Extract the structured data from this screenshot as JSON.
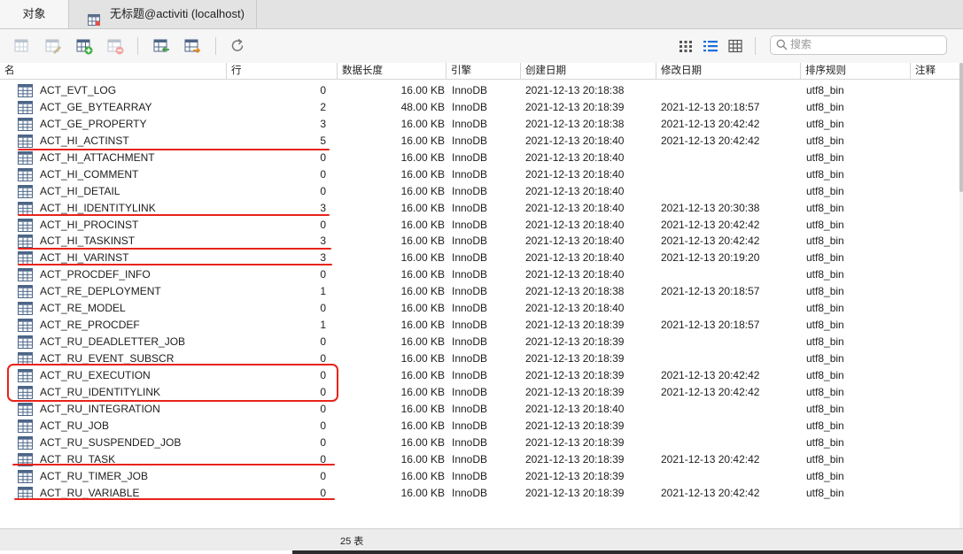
{
  "tabs": {
    "objects": "对象",
    "query": "无标题@activiti (localhost)"
  },
  "search": {
    "placeholder": "搜索"
  },
  "toolbar": {
    "icons": [
      "open-table-icon",
      "design-table-icon",
      "new-table-icon",
      "delete-table-icon",
      "import-icon",
      "export-icon",
      "refresh-icon",
      "view-icons-icon",
      "view-list-icon",
      "view-detail-icon"
    ]
  },
  "columns": {
    "name": "名",
    "rows": "行",
    "data_length": "数据长度",
    "engine": "引擎",
    "created": "创建日期",
    "modified": "修改日期",
    "collation": "排序规则",
    "comment": "注释"
  },
  "tables": [
    {
      "name": "ACT_EVT_LOG",
      "rows": "0",
      "len": "16.00 KB",
      "engine": "InnoDB",
      "created": "2021-12-13 20:18:38",
      "modified": "",
      "coll": "utf8_bin"
    },
    {
      "name": "ACT_GE_BYTEARRAY",
      "rows": "2",
      "len": "48.00 KB",
      "engine": "InnoDB",
      "created": "2021-12-13 20:18:39",
      "modified": "2021-12-13 20:18:57",
      "coll": "utf8_bin"
    },
    {
      "name": "ACT_GE_PROPERTY",
      "rows": "3",
      "len": "16.00 KB",
      "engine": "InnoDB",
      "created": "2021-12-13 20:18:38",
      "modified": "2021-12-13 20:42:42",
      "coll": "utf8_bin"
    },
    {
      "name": "ACT_HI_ACTINST",
      "rows": "5",
      "len": "16.00 KB",
      "engine": "InnoDB",
      "created": "2021-12-13 20:18:40",
      "modified": "2021-12-13 20:42:42",
      "coll": "utf8_bin"
    },
    {
      "name": "ACT_HI_ATTACHMENT",
      "rows": "0",
      "len": "16.00 KB",
      "engine": "InnoDB",
      "created": "2021-12-13 20:18:40",
      "modified": "",
      "coll": "utf8_bin"
    },
    {
      "name": "ACT_HI_COMMENT",
      "rows": "0",
      "len": "16.00 KB",
      "engine": "InnoDB",
      "created": "2021-12-13 20:18:40",
      "modified": "",
      "coll": "utf8_bin"
    },
    {
      "name": "ACT_HI_DETAIL",
      "rows": "0",
      "len": "16.00 KB",
      "engine": "InnoDB",
      "created": "2021-12-13 20:18:40",
      "modified": "",
      "coll": "utf8_bin"
    },
    {
      "name": "ACT_HI_IDENTITYLINK",
      "rows": "3",
      "len": "16.00 KB",
      "engine": "InnoDB",
      "created": "2021-12-13 20:18:40",
      "modified": "2021-12-13 20:30:38",
      "coll": "utf8_bin"
    },
    {
      "name": "ACT_HI_PROCINST",
      "rows": "0",
      "len": "16.00 KB",
      "engine": "InnoDB",
      "created": "2021-12-13 20:18:40",
      "modified": "2021-12-13 20:42:42",
      "coll": "utf8_bin"
    },
    {
      "name": "ACT_HI_TASKINST",
      "rows": "3",
      "len": "16.00 KB",
      "engine": "InnoDB",
      "created": "2021-12-13 20:18:40",
      "modified": "2021-12-13 20:42:42",
      "coll": "utf8_bin"
    },
    {
      "name": "ACT_HI_VARINST",
      "rows": "3",
      "len": "16.00 KB",
      "engine": "InnoDB",
      "created": "2021-12-13 20:18:40",
      "modified": "2021-12-13 20:19:20",
      "coll": "utf8_bin"
    },
    {
      "name": "ACT_PROCDEF_INFO",
      "rows": "0",
      "len": "16.00 KB",
      "engine": "InnoDB",
      "created": "2021-12-13 20:18:40",
      "modified": "",
      "coll": "utf8_bin"
    },
    {
      "name": "ACT_RE_DEPLOYMENT",
      "rows": "1",
      "len": "16.00 KB",
      "engine": "InnoDB",
      "created": "2021-12-13 20:18:38",
      "modified": "2021-12-13 20:18:57",
      "coll": "utf8_bin"
    },
    {
      "name": "ACT_RE_MODEL",
      "rows": "0",
      "len": "16.00 KB",
      "engine": "InnoDB",
      "created": "2021-12-13 20:18:40",
      "modified": "",
      "coll": "utf8_bin"
    },
    {
      "name": "ACT_RE_PROCDEF",
      "rows": "1",
      "len": "16.00 KB",
      "engine": "InnoDB",
      "created": "2021-12-13 20:18:39",
      "modified": "2021-12-13 20:18:57",
      "coll": "utf8_bin"
    },
    {
      "name": "ACT_RU_DEADLETTER_JOB",
      "rows": "0",
      "len": "16.00 KB",
      "engine": "InnoDB",
      "created": "2021-12-13 20:18:39",
      "modified": "",
      "coll": "utf8_bin"
    },
    {
      "name": "ACT_RU_EVENT_SUBSCR",
      "rows": "0",
      "len": "16.00 KB",
      "engine": "InnoDB",
      "created": "2021-12-13 20:18:39",
      "modified": "",
      "coll": "utf8_bin"
    },
    {
      "name": "ACT_RU_EXECUTION",
      "rows": "0",
      "len": "16.00 KB",
      "engine": "InnoDB",
      "created": "2021-12-13 20:18:39",
      "modified": "2021-12-13 20:42:42",
      "coll": "utf8_bin"
    },
    {
      "name": "ACT_RU_IDENTITYLINK",
      "rows": "0",
      "len": "16.00 KB",
      "engine": "InnoDB",
      "created": "2021-12-13 20:18:39",
      "modified": "2021-12-13 20:42:42",
      "coll": "utf8_bin"
    },
    {
      "name": "ACT_RU_INTEGRATION",
      "rows": "0",
      "len": "16.00 KB",
      "engine": "InnoDB",
      "created": "2021-12-13 20:18:40",
      "modified": "",
      "coll": "utf8_bin"
    },
    {
      "name": "ACT_RU_JOB",
      "rows": "0",
      "len": "16.00 KB",
      "engine": "InnoDB",
      "created": "2021-12-13 20:18:39",
      "modified": "",
      "coll": "utf8_bin"
    },
    {
      "name": "ACT_RU_SUSPENDED_JOB",
      "rows": "0",
      "len": "16.00 KB",
      "engine": "InnoDB",
      "created": "2021-12-13 20:18:39",
      "modified": "",
      "coll": "utf8_bin"
    },
    {
      "name": "ACT_RU_TASK",
      "rows": "0",
      "len": "16.00 KB",
      "engine": "InnoDB",
      "created": "2021-12-13 20:18:39",
      "modified": "2021-12-13 20:42:42",
      "coll": "utf8_bin"
    },
    {
      "name": "ACT_RU_TIMER_JOB",
      "rows": "0",
      "len": "16.00 KB",
      "engine": "InnoDB",
      "created": "2021-12-13 20:18:39",
      "modified": "",
      "coll": "utf8_bin"
    },
    {
      "name": "ACT_RU_VARIABLE",
      "rows": "0",
      "len": "16.00 KB",
      "engine": "InnoDB",
      "created": "2021-12-13 20:18:39",
      "modified": "2021-12-13 20:42:42",
      "coll": "utf8_bin"
    }
  ],
  "status": {
    "count": "25 表"
  },
  "annotation_color": "#e8231a"
}
